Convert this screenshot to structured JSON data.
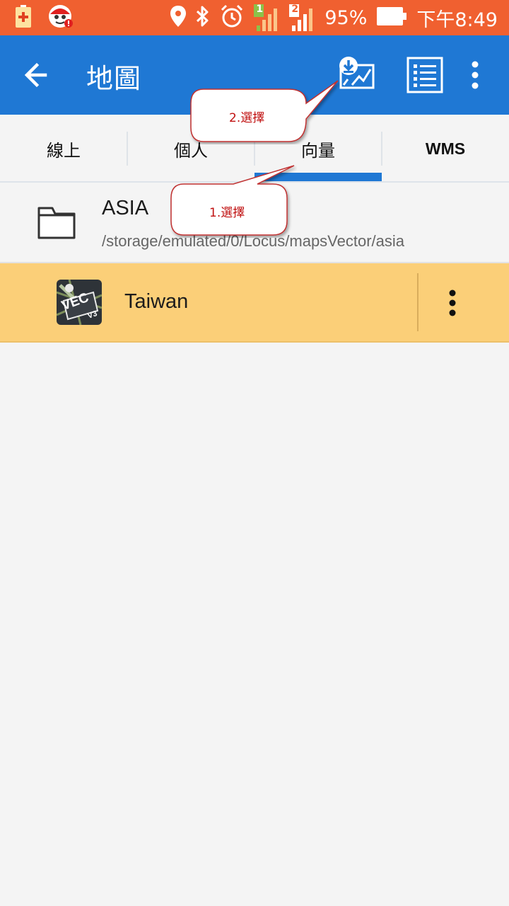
{
  "status_bar": {
    "battery_percent": "95%",
    "time": "下午8:49",
    "sim1_label": "1",
    "sim2_label": "2",
    "colors": {
      "background": "#f06030"
    }
  },
  "app_bar": {
    "title": "地圖",
    "back_icon": "arrow-left-icon",
    "download_icon": "download-map-icon",
    "list_icon": "list-icon",
    "more_icon": "more-vert-icon",
    "colors": {
      "background": "#1f78d4"
    }
  },
  "tabs": [
    {
      "label": "線上",
      "selected": false
    },
    {
      "label": "個人",
      "selected": false
    },
    {
      "label": "向量",
      "selected": true
    },
    {
      "label": "WMS",
      "selected": false
    }
  ],
  "folder": {
    "name": "ASIA",
    "path": "/storage/emulated/0/Locus/mapsVector/asia"
  },
  "map_item": {
    "name": "Taiwan",
    "icon_text": "VEC",
    "icon_version": "V3",
    "colors": {
      "highlight": "#fbcf78"
    }
  },
  "annotations": {
    "callout_1": "1.選擇",
    "callout_2": "2.選擇",
    "color": "#c01010"
  }
}
